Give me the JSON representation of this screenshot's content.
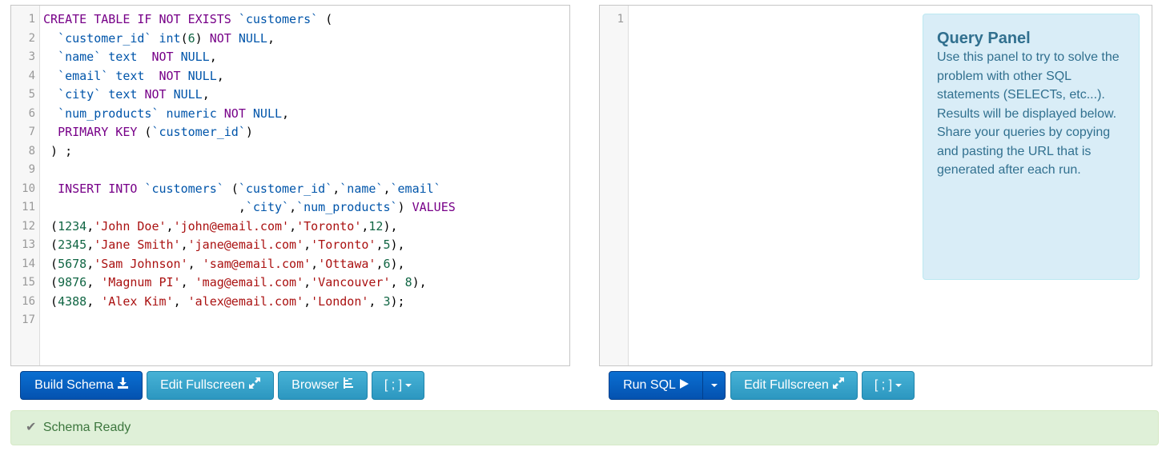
{
  "schema_editor": {
    "line_numbers": [
      "1",
      "2",
      "3",
      "4",
      "5",
      "6",
      "7",
      "8",
      "9",
      "10",
      "11",
      "12",
      "13",
      "14",
      "15",
      "16",
      "17"
    ],
    "lines": [
      [
        [
          "kw",
          "CREATE TABLE IF NOT EXISTS "
        ],
        [
          "id",
          "`customers`"
        ],
        [
          "p",
          " ("
        ]
      ],
      [
        [
          "p",
          "  "
        ],
        [
          "id",
          "`customer_id`"
        ],
        [
          "p",
          " "
        ],
        [
          "ty",
          "int"
        ],
        [
          "p",
          "("
        ],
        [
          "num",
          "6"
        ],
        [
          "p",
          ") "
        ],
        [
          "kw",
          "NOT"
        ],
        [
          "p",
          " "
        ],
        [
          "kw2",
          "NULL"
        ],
        [
          "p",
          ","
        ]
      ],
      [
        [
          "p",
          "  "
        ],
        [
          "id",
          "`name`"
        ],
        [
          "p",
          " "
        ],
        [
          "ty",
          "text"
        ],
        [
          "p",
          "  "
        ],
        [
          "kw",
          "NOT"
        ],
        [
          "p",
          " "
        ],
        [
          "kw2",
          "NULL"
        ],
        [
          "p",
          ","
        ]
      ],
      [
        [
          "p",
          "  "
        ],
        [
          "id",
          "`email`"
        ],
        [
          "p",
          " "
        ],
        [
          "ty",
          "text"
        ],
        [
          "p",
          "  "
        ],
        [
          "kw",
          "NOT"
        ],
        [
          "p",
          " "
        ],
        [
          "kw2",
          "NULL"
        ],
        [
          "p",
          ","
        ]
      ],
      [
        [
          "p",
          "  "
        ],
        [
          "id",
          "`city`"
        ],
        [
          "p",
          " "
        ],
        [
          "ty",
          "text"
        ],
        [
          "p",
          " "
        ],
        [
          "kw",
          "NOT"
        ],
        [
          "p",
          " "
        ],
        [
          "kw2",
          "NULL"
        ],
        [
          "p",
          ","
        ]
      ],
      [
        [
          "p",
          "  "
        ],
        [
          "id",
          "`num_products`"
        ],
        [
          "p",
          " "
        ],
        [
          "ty",
          "numeric"
        ],
        [
          "p",
          " "
        ],
        [
          "kw",
          "NOT"
        ],
        [
          "p",
          " "
        ],
        [
          "kw2",
          "NULL"
        ],
        [
          "p",
          ","
        ]
      ],
      [
        [
          "p",
          "  "
        ],
        [
          "kw",
          "PRIMARY KEY"
        ],
        [
          "p",
          " ("
        ],
        [
          "id",
          "`customer_id`"
        ],
        [
          "p",
          ")"
        ]
      ],
      [
        [
          "p",
          " ) ;"
        ]
      ],
      [
        [
          "p",
          ""
        ]
      ],
      [
        [
          "p",
          "  "
        ],
        [
          "kw",
          "INSERT INTO"
        ],
        [
          "p",
          " "
        ],
        [
          "id",
          "`customers`"
        ],
        [
          "p",
          " ("
        ],
        [
          "id",
          "`customer_id`"
        ],
        [
          "p",
          ","
        ],
        [
          "id",
          "`name`"
        ],
        [
          "p",
          ","
        ],
        [
          "id",
          "`email`"
        ]
      ],
      [
        [
          "p",
          "                           ,"
        ],
        [
          "id",
          "`city`"
        ],
        [
          "p",
          ","
        ],
        [
          "id",
          "`num_products`"
        ],
        [
          "p",
          ") "
        ],
        [
          "kw",
          "VALUES"
        ]
      ],
      [
        [
          "p",
          " ("
        ],
        [
          "num",
          "1234"
        ],
        [
          "p",
          ","
        ],
        [
          "str",
          "'John Doe'"
        ],
        [
          "p",
          ","
        ],
        [
          "str",
          "'john@email.com'"
        ],
        [
          "p",
          ","
        ],
        [
          "str",
          "'Toronto'"
        ],
        [
          "p",
          ","
        ],
        [
          "num",
          "12"
        ],
        [
          "p",
          "),"
        ]
      ],
      [
        [
          "p",
          " ("
        ],
        [
          "num",
          "2345"
        ],
        [
          "p",
          ","
        ],
        [
          "str",
          "'Jane Smith'"
        ],
        [
          "p",
          ","
        ],
        [
          "str",
          "'jane@email.com'"
        ],
        [
          "p",
          ","
        ],
        [
          "str",
          "'Toronto'"
        ],
        [
          "p",
          ","
        ],
        [
          "num",
          "5"
        ],
        [
          "p",
          "),"
        ]
      ],
      [
        [
          "p",
          " ("
        ],
        [
          "num",
          "5678"
        ],
        [
          "p",
          ","
        ],
        [
          "str",
          "'Sam Johnson'"
        ],
        [
          "p",
          ", "
        ],
        [
          "str",
          "'sam@email.com'"
        ],
        [
          "p",
          ","
        ],
        [
          "str",
          "'Ottawa'"
        ],
        [
          "p",
          ","
        ],
        [
          "num",
          "6"
        ],
        [
          "p",
          "),"
        ]
      ],
      [
        [
          "p",
          " ("
        ],
        [
          "num",
          "9876"
        ],
        [
          "p",
          ", "
        ],
        [
          "str",
          "'Magnum PI'"
        ],
        [
          "p",
          ", "
        ],
        [
          "str",
          "'mag@email.com'"
        ],
        [
          "p",
          ","
        ],
        [
          "str",
          "'Vancouver'"
        ],
        [
          "p",
          ", "
        ],
        [
          "num",
          "8"
        ],
        [
          "p",
          "),"
        ]
      ],
      [
        [
          "p",
          " ("
        ],
        [
          "num",
          "4388"
        ],
        [
          "p",
          ", "
        ],
        [
          "str",
          "'Alex Kim'"
        ],
        [
          "p",
          ", "
        ],
        [
          "str",
          "'alex@email.com'"
        ],
        [
          "p",
          ","
        ],
        [
          "str",
          "'London'"
        ],
        [
          "p",
          ", "
        ],
        [
          "num",
          "3"
        ],
        [
          "p",
          ");"
        ]
      ],
      [
        [
          "p",
          ""
        ]
      ]
    ]
  },
  "query_editor": {
    "line_numbers": [
      "1"
    ]
  },
  "query_panel": {
    "title": "Query Panel",
    "body": "Use this panel to try to solve the problem with other SQL statements (SELECTs, etc...). Results will be displayed below. Share your queries by copying and pasting the URL that is generated after each run."
  },
  "schema_toolbar": {
    "build_schema": "Build Schema",
    "edit_fullscreen": "Edit Fullscreen",
    "browser": "Browser",
    "delimiter": "[ ; ]"
  },
  "query_toolbar": {
    "run_sql": "Run SQL",
    "edit_fullscreen": "Edit Fullscreen",
    "delimiter": "[ ; ]"
  },
  "status": {
    "text": "Schema Ready"
  },
  "icons": {
    "build_schema": "download-icon",
    "edit_fullscreen": "expand-icon",
    "browser": "tree-list-icon",
    "run_sql": "play-icon",
    "status": "check-icon"
  },
  "colors": {
    "primary": "#0452b0",
    "info": "#2c97c0",
    "success_bg": "#dff0d8",
    "keyword": "#770088",
    "string": "#aa1111",
    "number": "#116644",
    "identifier": "#0055aa"
  }
}
